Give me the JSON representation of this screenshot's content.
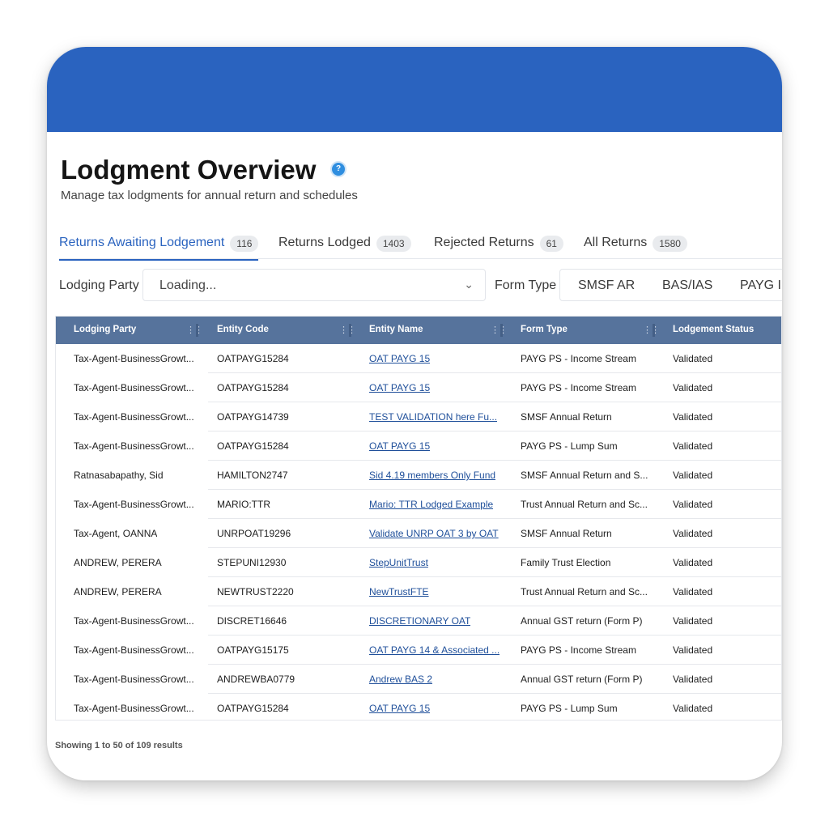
{
  "page": {
    "title": "Lodgment Overview",
    "subtitle": "Manage tax lodgments for annual return and schedules"
  },
  "tabs": [
    {
      "label": "Returns Awaiting Lodgement",
      "count": "116"
    },
    {
      "label": "Returns Lodged",
      "count": "1403"
    },
    {
      "label": "Rejected Returns",
      "count": "61"
    },
    {
      "label": "All Returns",
      "count": "1580"
    }
  ],
  "filters": {
    "lodging_party": {
      "label": "Lodging Party",
      "value": "Loading..."
    },
    "form_type": {
      "label": "Form Type",
      "options": [
        "SMSF AR",
        "BAS/IAS",
        "PAYG I"
      ]
    }
  },
  "table": {
    "columns": [
      "Lodging Party",
      "Entity Code",
      "Entity Name",
      "Form Type",
      "Lodgement Status"
    ],
    "rows": [
      [
        "Tax-Agent-BusinessGrowt...",
        "OATPAYG15284",
        "OAT PAYG 15",
        "PAYG PS - Income Stream",
        "Validated"
      ],
      [
        "Tax-Agent-BusinessGrowt...",
        "OATPAYG15284",
        "OAT PAYG 15",
        "PAYG PS - Income Stream",
        "Validated"
      ],
      [
        "Tax-Agent-BusinessGrowt...",
        "OATPAYG14739",
        "TEST VALIDATION here Fu...",
        "SMSF Annual Return",
        "Validated"
      ],
      [
        "Tax-Agent-BusinessGrowt...",
        "OATPAYG15284",
        "OAT PAYG 15",
        "PAYG PS - Lump Sum",
        "Validated"
      ],
      [
        "Ratnasabapathy, Sid",
        "HAMILTON2747",
        "Sid 4.19 members Only Fund",
        "SMSF Annual Return and S...",
        "Validated"
      ],
      [
        "Tax-Agent-BusinessGrowt...",
        "MARIO:TTR",
        "Mario: TTR Lodged Example",
        "Trust Annual Return and Sc...",
        "Validated"
      ],
      [
        "Tax-Agent, OANNA",
        "UNRPOAT19296",
        "Validate UNRP OAT 3 by OAT",
        "SMSF Annual Return",
        "Validated"
      ],
      [
        "ANDREW, PERERA",
        "STEPUNI12930",
        "StepUnitTrust",
        "Family Trust Election",
        "Validated"
      ],
      [
        "ANDREW, PERERA",
        "NEWTRUST2220",
        "NewTrustFTE",
        "Trust Annual Return and Sc...",
        "Validated"
      ],
      [
        "Tax-Agent-BusinessGrowt...",
        "DISCRET16646",
        "DISCRETIONARY OAT",
        "Annual GST return (Form P)",
        "Validated"
      ],
      [
        "Tax-Agent-BusinessGrowt...",
        "OATPAYG15175",
        "OAT PAYG 14 & Associated ...",
        "PAYG PS - Income Stream",
        "Validated"
      ],
      [
        "Tax-Agent-BusinessGrowt...",
        "ANDREWBA0779",
        "Andrew BAS 2",
        "Annual GST return (Form P)",
        "Validated"
      ],
      [
        "Tax-Agent-BusinessGrowt...",
        "OATPAYG15284",
        "OAT PAYG 15",
        "PAYG PS - Lump Sum",
        "Validated"
      ]
    ]
  },
  "footer": {
    "text": "Showing 1 to 50 of 109 results"
  },
  "icons": {
    "help": "help-circle-icon",
    "dropdown": "chevron-down-icon",
    "column_menu": "column-grip-icon"
  },
  "colors": {
    "banner": "#2a63bf",
    "table_header": "#56739c",
    "link": "#1f4f9a"
  }
}
